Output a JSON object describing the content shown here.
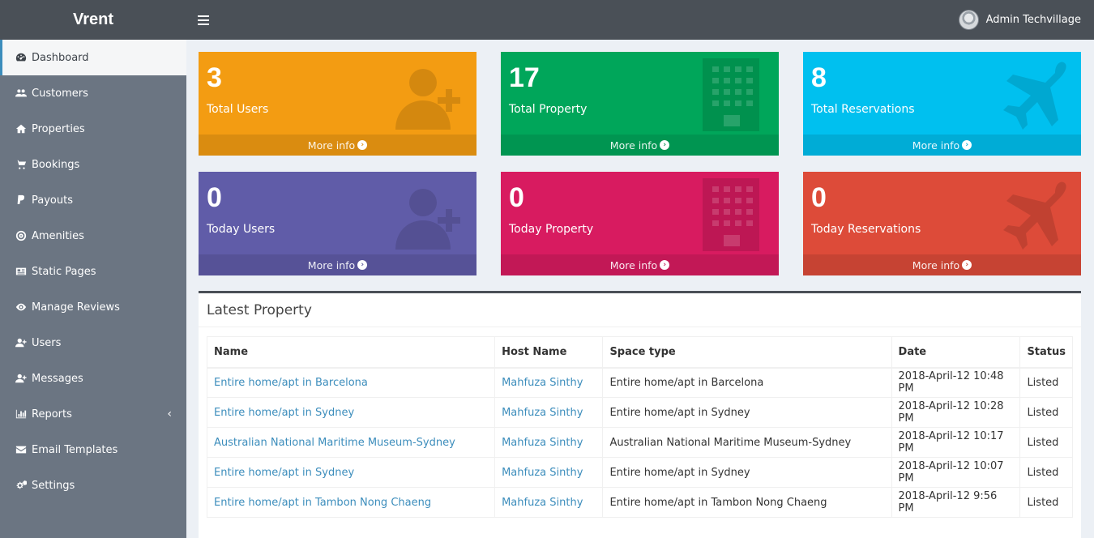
{
  "header": {
    "brand": "Vrent",
    "user_name": "Admin Techvillage"
  },
  "sidebar": {
    "items": [
      {
        "label": "Dashboard",
        "icon": "dashboard-icon",
        "active": true
      },
      {
        "label": "Customers",
        "icon": "users-icon"
      },
      {
        "label": "Properties",
        "icon": "home-icon"
      },
      {
        "label": "Bookings",
        "icon": "cart-icon"
      },
      {
        "label": "Payouts",
        "icon": "paypal-icon"
      },
      {
        "label": "Amenities",
        "icon": "bullseye-icon"
      },
      {
        "label": "Static Pages",
        "icon": "newspaper-icon"
      },
      {
        "label": "Manage Reviews",
        "icon": "eye-icon"
      },
      {
        "label": "Users",
        "icon": "user-plus-icon"
      },
      {
        "label": "Messages",
        "icon": "user-plus-icon"
      },
      {
        "label": "Reports",
        "icon": "bar-chart-icon"
      },
      {
        "label": "Email Templates",
        "icon": "envelope-icon"
      },
      {
        "label": "Settings",
        "icon": "gears-icon"
      }
    ]
  },
  "stats": [
    {
      "value": "3",
      "label": "Total Users",
      "more": "More info",
      "color": "#f39c12",
      "footer_color": "#da8c10",
      "icon": "user-plus-icon"
    },
    {
      "value": "17",
      "label": "Total Property",
      "more": "More info",
      "color": "#00a65a",
      "footer_color": "#009551",
      "icon": "building-icon"
    },
    {
      "value": "8",
      "label": "Total Reservations",
      "more": "More info",
      "color": "#00c0ef",
      "footer_color": "#00acd6",
      "icon": "plane-icon"
    },
    {
      "value": "0",
      "label": "Today Users",
      "more": "More info",
      "color": "#605ca8",
      "footer_color": "#565297",
      "icon": "user-plus-icon"
    },
    {
      "value": "0",
      "label": "Today Property",
      "more": "More info",
      "color": "#d81b60",
      "footer_color": "#c21856",
      "icon": "building-icon"
    },
    {
      "value": "0",
      "label": "Today Reservations",
      "more": "More info",
      "color": "#dd4b39",
      "footer_color": "#c64333",
      "icon": "plane-icon"
    }
  ],
  "latest": {
    "title": "Latest Property",
    "columns": [
      "Name",
      "Host Name",
      "Space type",
      "Date",
      "Status"
    ],
    "rows": [
      [
        "Entire home/apt in Barcelona",
        "Mahfuza Sinthy",
        "Entire home/apt in Barcelona",
        "2018-April-12 10:48 PM",
        "Listed"
      ],
      [
        "Entire home/apt in Sydney",
        "Mahfuza Sinthy",
        "Entire home/apt in Sydney",
        "2018-April-12 10:28 PM",
        "Listed"
      ],
      [
        "Australian National Maritime Museum-Sydney",
        "Mahfuza Sinthy",
        "Australian National Maritime Museum-Sydney",
        "2018-April-12 10:17 PM",
        "Listed"
      ],
      [
        "Entire home/apt in Sydney",
        "Mahfuza Sinthy",
        "Entire home/apt in Sydney",
        "2018-April-12 10:07 PM",
        "Listed"
      ],
      [
        "Entire home/apt in Tambon Nong Chaeng",
        "Mahfuza Sinthy",
        "Entire home/apt in Tambon Nong Chaeng",
        "2018-April-12 9:56 PM",
        "Listed"
      ]
    ]
  }
}
